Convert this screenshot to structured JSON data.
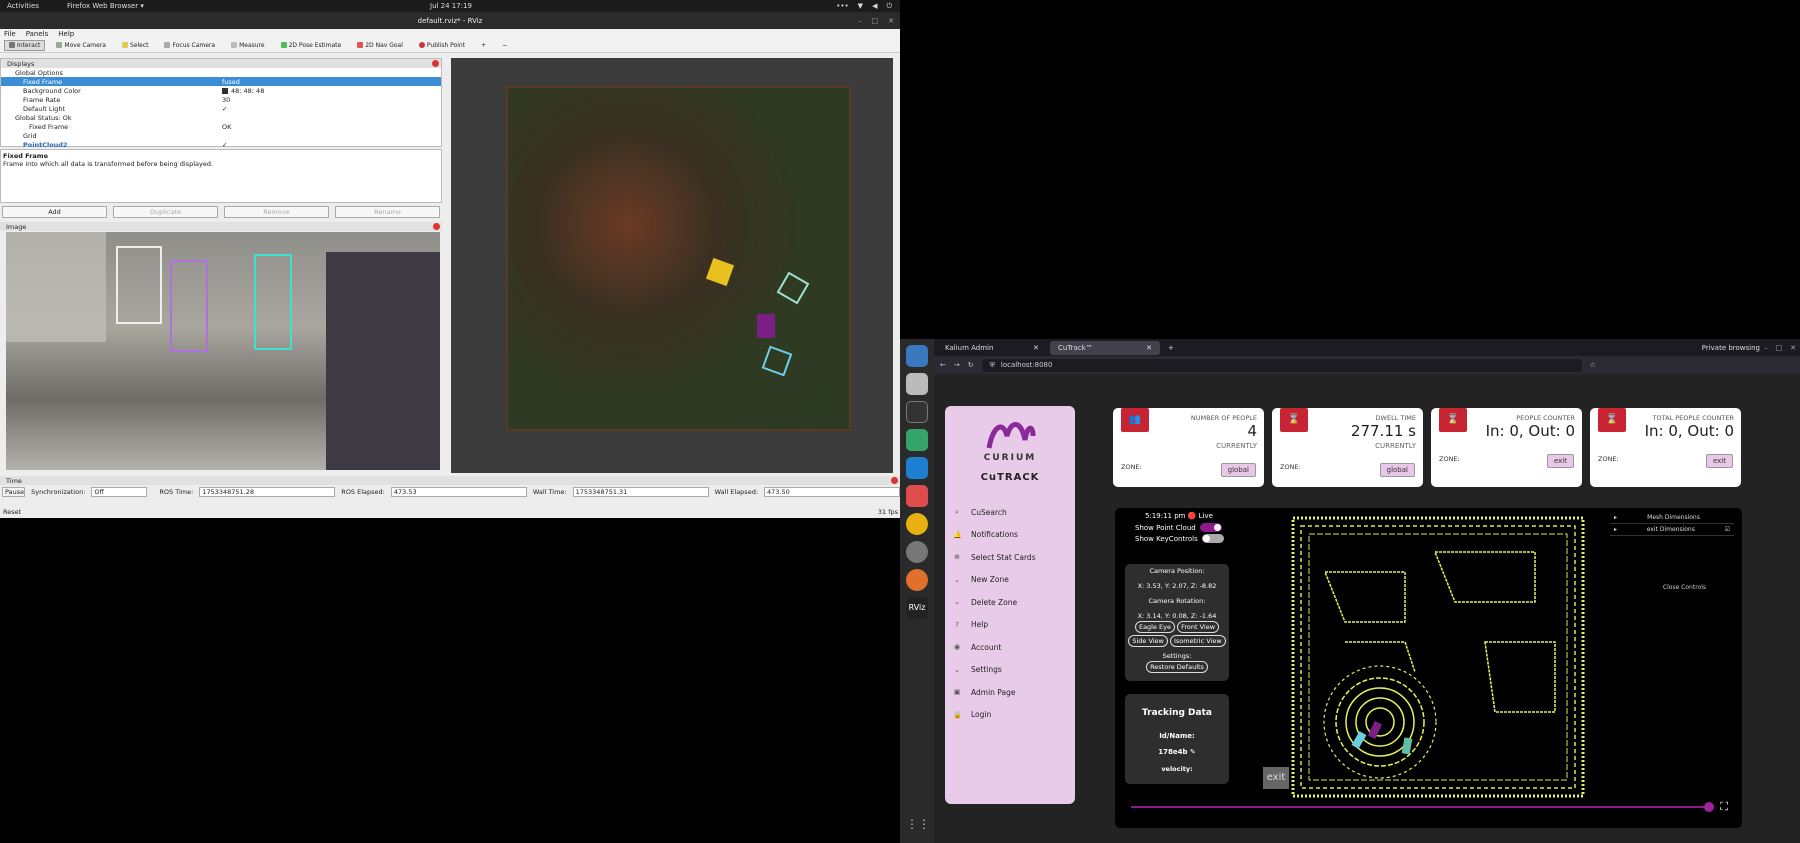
{
  "gnome": {
    "activities": "Activities",
    "app": "Firefox Web Browser ▾",
    "clock": "Jul 24  17:19"
  },
  "rviz": {
    "title": "default.rviz* - RViz",
    "menu": [
      "File",
      "Panels",
      "Help"
    ],
    "tools": [
      {
        "label": "Interact",
        "active": true
      },
      {
        "label": "Move Camera",
        "active": false
      },
      {
        "label": "Select",
        "active": false
      },
      {
        "label": "Focus Camera",
        "active": false
      },
      {
        "label": "Measure",
        "active": false
      },
      {
        "label": "2D Pose Estimate",
        "active": false
      },
      {
        "label": "2D Nav Goal",
        "active": false
      },
      {
        "label": "Publish Point",
        "active": false
      }
    ],
    "displays_title": "Displays",
    "display_rows": [
      {
        "k": "Global Options",
        "v": ""
      },
      {
        "k": "Fixed Frame",
        "v": "fused"
      },
      {
        "k": "Background Color",
        "v": "48; 48; 48"
      },
      {
        "k": "Frame Rate",
        "v": "30"
      },
      {
        "k": "Default Light",
        "v": "✓"
      },
      {
        "k": "Global Status: Ok",
        "v": ""
      },
      {
        "k": "Fixed Frame",
        "v": "OK"
      },
      {
        "k": "Grid",
        "v": ""
      },
      {
        "k": "PointCloud2",
        "v": "✓"
      }
    ],
    "desc_title": "Fixed Frame",
    "desc_text": "Frame into which all data is transformed before being displayed.",
    "buttons": [
      "Add",
      "Duplicate",
      "Remove",
      "Rename"
    ],
    "image_title": "Image",
    "time_title": "Time",
    "pause": "Pause",
    "sync_label": "Synchronization:",
    "sync_value": "Off",
    "ros_time_label": "ROS Time:",
    "ros_time": "1753348751.28",
    "ros_elapsed_label": "ROS Elapsed:",
    "ros_elapsed": "473.53",
    "wall_time_label": "Wall Time:",
    "wall_time": "1753348751.31",
    "wall_elapsed_label": "Wall Elapsed:",
    "wall_elapsed": "473.50",
    "reset": "Reset",
    "fps": "31 fps"
  },
  "firefox": {
    "tabs": [
      "Kalium Admin",
      "CuTrack™"
    ],
    "private": "Private browsing",
    "url": "localhost:8080"
  },
  "cutrack": {
    "brand": "CURIUM",
    "product": "CuTRACK",
    "menu": [
      {
        "icon": "⌕",
        "label": "CuSearch"
      },
      {
        "icon": "🔔",
        "label": "Notifications"
      },
      {
        "icon": "⊕",
        "label": "Select Stat Cards"
      },
      {
        "icon": "⌄",
        "label": "New Zone"
      },
      {
        "icon": "⌄",
        "label": "Delete Zone"
      },
      {
        "icon": "?",
        "label": "Help"
      },
      {
        "icon": "◉",
        "label": "Account"
      },
      {
        "icon": "⌄",
        "label": "Settings"
      },
      {
        "icon": "▣",
        "label": "Admin Page"
      },
      {
        "icon": "🔒",
        "label": "Login"
      }
    ],
    "cards": [
      {
        "label": "NUMBER OF PEOPLE",
        "value": "4",
        "sub": "CURRENTLY",
        "zone": "ZONE:",
        "btn": "global"
      },
      {
        "label": "DWELL TIME",
        "value": "277.11 s",
        "sub": "CURRENTLY",
        "zone": "ZONE:",
        "btn": "global"
      },
      {
        "label": "PEOPLE COUNTER",
        "value": "In: 0, Out: 0",
        "sub": "",
        "zone": "ZONE:",
        "btn": "exit"
      },
      {
        "label": "TOTAL PEOPLE COUNTER",
        "value": "In: 0, Out: 0",
        "sub": "",
        "zone": "ZONE:",
        "btn": "exit"
      }
    ],
    "viewer": {
      "time": "5:19:11 pm 🔴 Live",
      "show_point_cloud": "Show Point Cloud",
      "show_key_controls": "Show KeyControls",
      "cam_pos_label": "Camera Position:",
      "cam_pos": "X: 3.53, Y: 2.07, Z: -8.82",
      "cam_rot_label": "Camera Rotation:",
      "cam_rot": "X: 3.14, Y: 0.08, Z: -1.64",
      "view_buttons": [
        "Eagle Eye",
        "Front View",
        "Side View",
        "Isometric View"
      ],
      "settings_label": "Settings:",
      "restore": "Restore Defaults",
      "tracking_title": "Tracking Data",
      "id_label": "Id/Name:",
      "id_value": "178e4b",
      "velocity": "velocity:",
      "exit": "exit",
      "mesh_dims": "Mesh Dimensions",
      "exit_dims": "exit Dimensions",
      "close_controls": "Close Controls"
    }
  }
}
